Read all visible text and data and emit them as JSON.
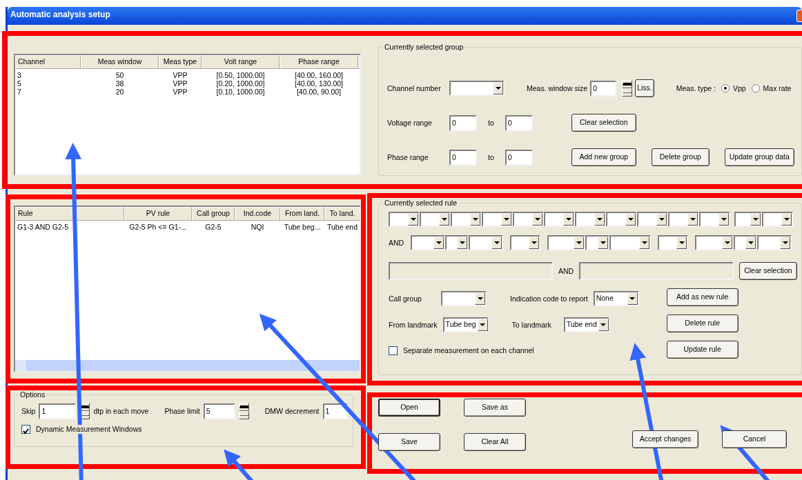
{
  "window": {
    "title": "Automatic analysis setup"
  },
  "groups_table": {
    "columns": [
      "Channel",
      "Meas window",
      "Meas type",
      "Volt range",
      "Phase range"
    ],
    "rows": [
      [
        "3",
        "50",
        "VPP",
        "[0.50, 1000.00]",
        "[40.00, 160.00]"
      ],
      [
        "5",
        "38",
        "VPP",
        "[0.20, 1000.00]",
        "[40.00, 130.00]"
      ],
      [
        "7",
        "20",
        "VPP",
        "[0.10, 1000.00]",
        "[40.00, 90.00]"
      ]
    ]
  },
  "group_editor": {
    "title": "Currently selected group",
    "channel_label": "Channel number",
    "window_label": "Meas. window size",
    "window_value": "0",
    "liss_button": "Liss.",
    "type_label": "Meas. type :",
    "types": [
      {
        "label": "Vpp",
        "selected": true
      },
      {
        "label": "Max rate",
        "selected": false
      }
    ],
    "ranges": [
      {
        "label": "Voltage range",
        "from": "0",
        "to_label": "to",
        "to": "0"
      },
      {
        "label": "Phase range",
        "from": "0",
        "to_label": "to",
        "to": "0"
      }
    ],
    "clear_button": "Clear selection",
    "buttons": [
      "Add new group",
      "Delete group",
      "Update group data"
    ]
  },
  "rules_table": {
    "columns": [
      "Rule",
      "PV rule",
      "Call group",
      "Ind.code",
      "From land.",
      "To land."
    ],
    "rows": [
      [
        "G1-3 AND G2-5",
        "G2-5 Ph <= G1-...",
        "G2-5",
        "NQI",
        "Tube beg...",
        "Tube end"
      ]
    ]
  },
  "rule_editor": {
    "title": "Currently selected rule",
    "and_label": "AND",
    "summary_and_label": "AND",
    "clear_button": "Clear selection",
    "call_group_label": "Call group",
    "indication_label": "Indication code to report",
    "indication_value": "None",
    "from_label": "From landmark",
    "from_value": "Tube beg",
    "to_label": "To landmark",
    "to_value": "Tube end",
    "separate": {
      "label": "Separate measurement on each channel",
      "checked": false
    },
    "buttons": [
      "Add as new rule",
      "Delete rule",
      "Update rule"
    ]
  },
  "options": {
    "title": "Options",
    "skip_label": "Skip",
    "skip_value": "1",
    "skip_unit": "dtp in each move",
    "phase_label": "Phase limit",
    "phase_value": "5",
    "dmw_label": "DMW decrement",
    "dmw_value": "1",
    "dynamic": {
      "label": "Dynamic Measurement Windows",
      "checked": true
    }
  },
  "actions": [
    {
      "label": "Open",
      "default": true
    },
    {
      "label": "Save as",
      "default": false
    },
    {
      "label": "Save",
      "default": false
    },
    {
      "label": "Clear All",
      "default": false
    },
    {
      "label": "Accept changes",
      "default": false
    },
    {
      "label": "Cancel",
      "default": false
    }
  ]
}
